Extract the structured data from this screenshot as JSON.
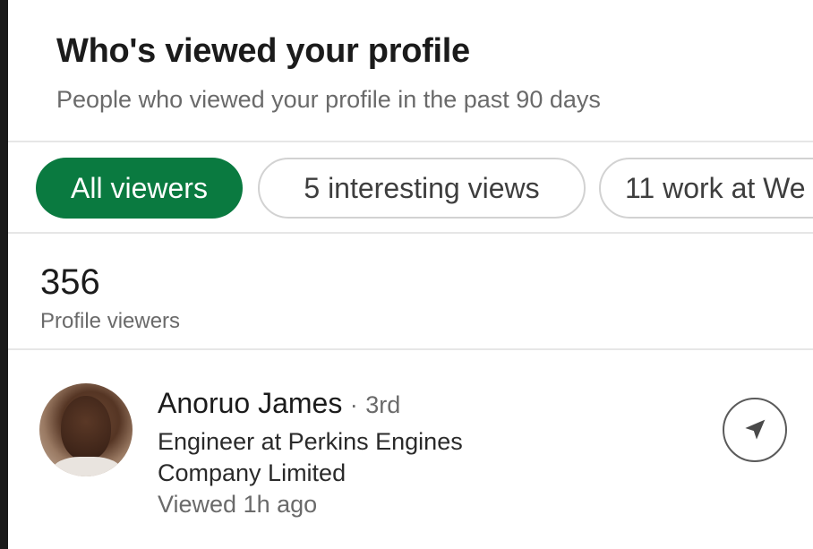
{
  "header": {
    "title": "Who's viewed your profile",
    "subtitle": "People who viewed your profile in the past 90 days"
  },
  "filters": [
    {
      "label": "All viewers",
      "selected": true
    },
    {
      "label": "5 interesting views",
      "selected": false
    },
    {
      "label": "11 work at We",
      "selected": false
    }
  ],
  "stats": {
    "count": "356",
    "label": "Profile viewers"
  },
  "viewers": [
    {
      "name": "Anoruo James",
      "separator": "·",
      "degree": "3rd",
      "headline": "Engineer at Perkins Engines Company Limited",
      "viewed": "Viewed 1h ago",
      "action_icon": "send-message-icon"
    }
  ],
  "colors": {
    "accent": "#0a7a40",
    "text_primary": "#1b1b1b",
    "text_secondary": "#6a6a6a",
    "divider": "#e6e6e6",
    "pill_border": "#d2d2d2"
  }
}
